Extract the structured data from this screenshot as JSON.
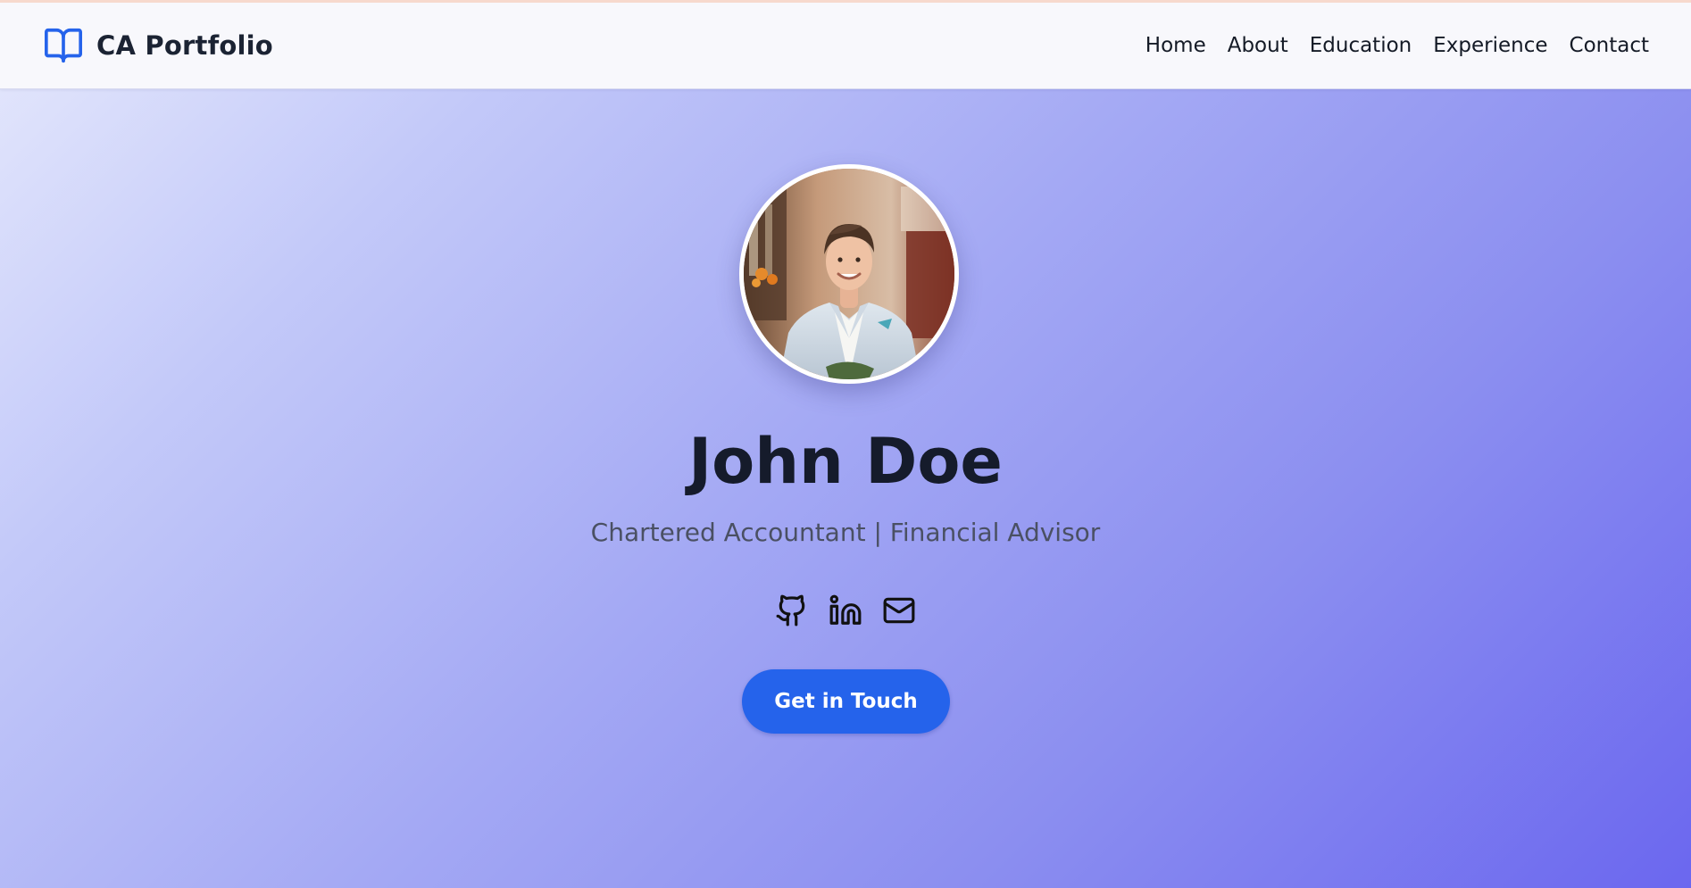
{
  "navbar": {
    "brand": {
      "name": "CA Portfolio",
      "icon": "book-open-icon"
    },
    "links": [
      {
        "label": "Home"
      },
      {
        "label": "About"
      },
      {
        "label": "Education"
      },
      {
        "label": "Experience"
      },
      {
        "label": "Contact"
      }
    ]
  },
  "hero": {
    "avatar_icon": "profile-photo",
    "name": "John Doe",
    "subtitle": "Chartered Accountant | Financial Advisor",
    "socials": [
      {
        "icon": "github-icon"
      },
      {
        "icon": "linkedin-icon"
      },
      {
        "icon": "mail-icon"
      }
    ],
    "cta_label": "Get in Touch"
  },
  "colors": {
    "accent": "#2563eb",
    "heading": "#151b2b",
    "subtitle": "#4a5063",
    "gradient_start": "#e6e9fc",
    "gradient_end": "#6b67ef"
  }
}
